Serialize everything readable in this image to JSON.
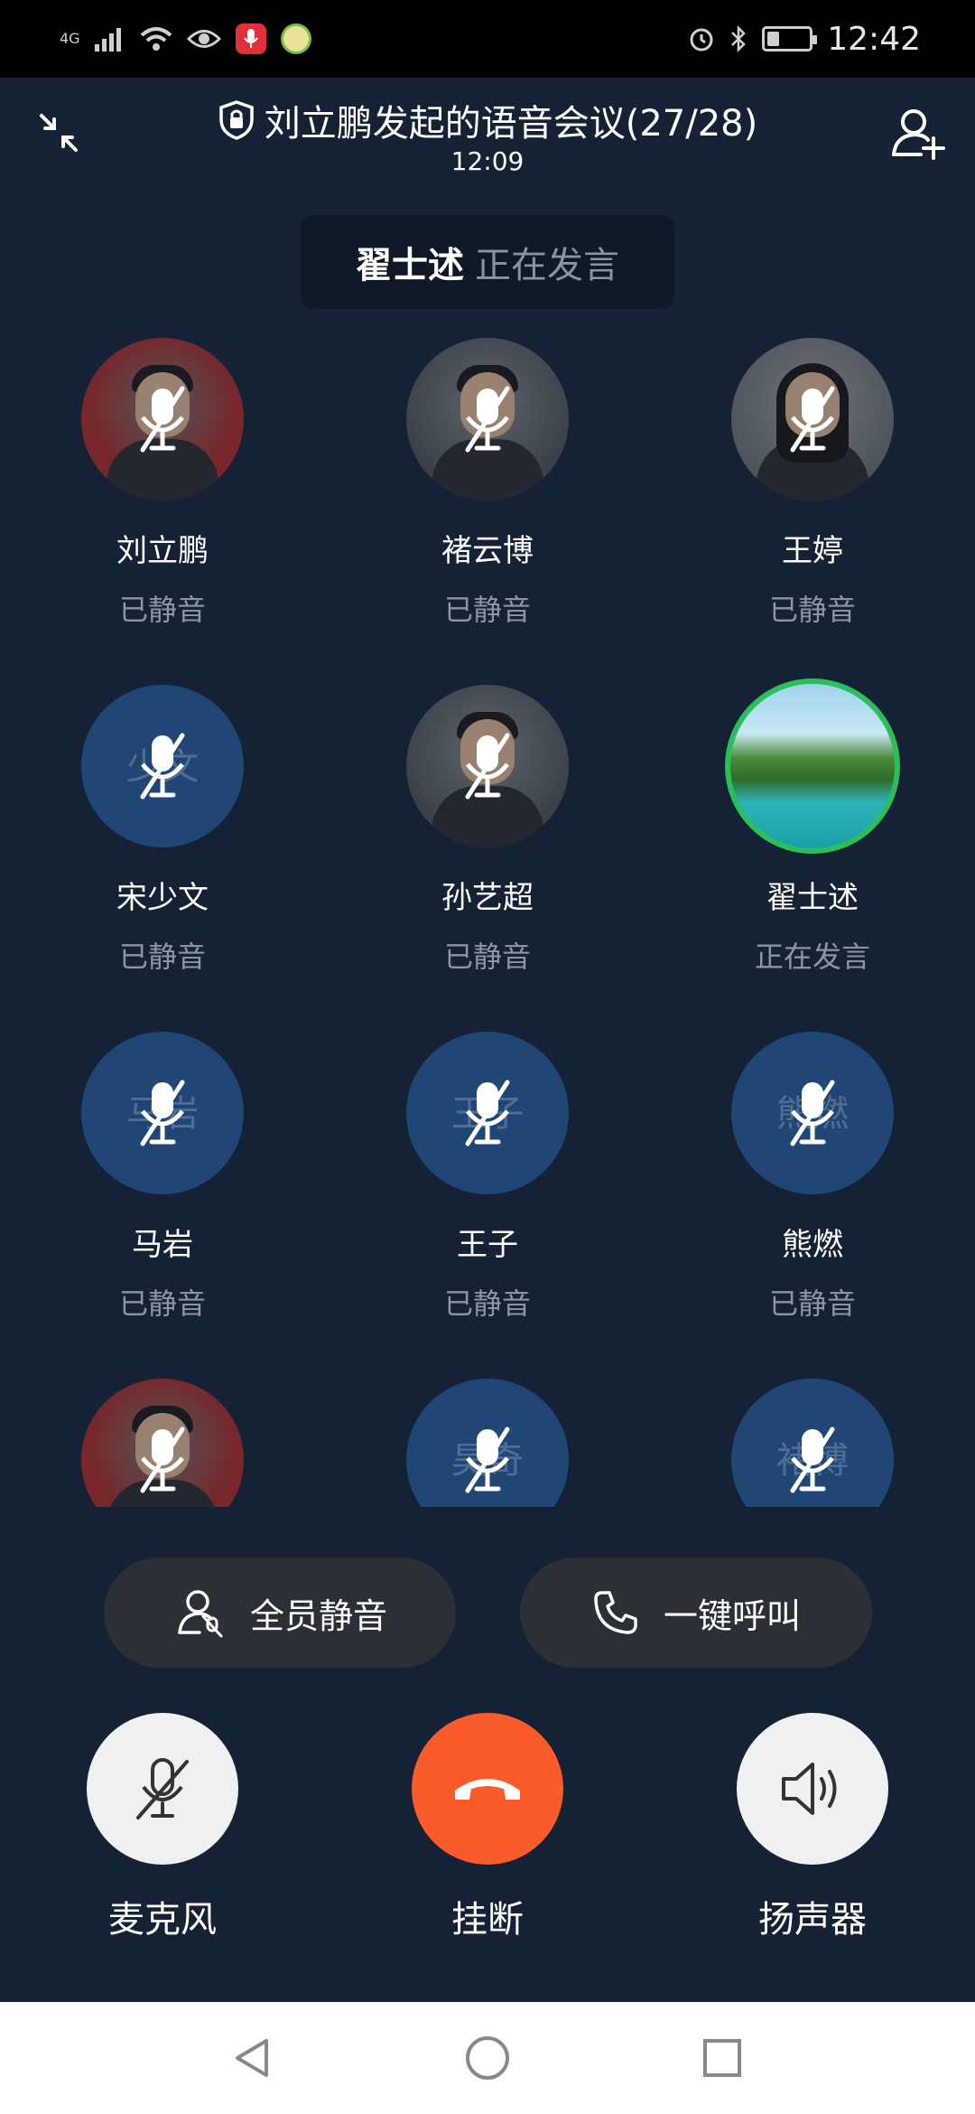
{
  "status_bar": {
    "network": "4G",
    "time": "12:42",
    "battery_level": 0.3
  },
  "header": {
    "title": "刘立鹏发起的语音会议(27/28)",
    "duration": "12:09"
  },
  "speaking_banner": {
    "name": "翟士述",
    "status": "正在发言"
  },
  "participants": [
    {
      "name": "刘立鹏",
      "status": "已静音",
      "avatar": "photo-red",
      "initials": ""
    },
    {
      "name": "褚云博",
      "status": "已静音",
      "avatar": "photo",
      "initials": ""
    },
    {
      "name": "王婷",
      "status": "已静音",
      "avatar": "photo-light",
      "initials": ""
    },
    {
      "name": "宋少文",
      "status": "已静音",
      "avatar": "initials",
      "initials": "少文"
    },
    {
      "name": "孙艺超",
      "status": "已静音",
      "avatar": "photo",
      "initials": ""
    },
    {
      "name": "翟士述",
      "status": "正在发言",
      "avatar": "landscape",
      "initials": ""
    },
    {
      "name": "马岩",
      "status": "已静音",
      "avatar": "initials",
      "initials": "马岩"
    },
    {
      "name": "王子",
      "status": "已静音",
      "avatar": "initials",
      "initials": "王子"
    },
    {
      "name": "熊燃",
      "status": "已静音",
      "avatar": "initials",
      "initials": "熊燃"
    },
    {
      "name": "",
      "status": "",
      "avatar": "photo-red",
      "initials": ""
    },
    {
      "name": "",
      "status": "",
      "avatar": "initials",
      "initials": "昊奇"
    },
    {
      "name": "",
      "status": "",
      "avatar": "initials",
      "initials": "褚博"
    }
  ],
  "actions": {
    "mute_all": "全员静音",
    "call_all": "一键呼叫"
  },
  "controls": {
    "mic": "麦克风",
    "hangup": "挂断",
    "speaker": "扬声器"
  },
  "colors": {
    "background": "#152236",
    "hangup": "#fb5a2a",
    "speaking_ring": "#2bbf5b",
    "initials_avatar": "#1f4675"
  },
  "icons": {
    "collapse": "collapse-arrows-icon",
    "add_member": "add-user-icon",
    "lock": "shield-lock-icon",
    "mic_off": "mic-off-icon",
    "phone": "phone-icon",
    "speaker": "speaker-icon",
    "hangup": "phone-hangup-icon"
  }
}
